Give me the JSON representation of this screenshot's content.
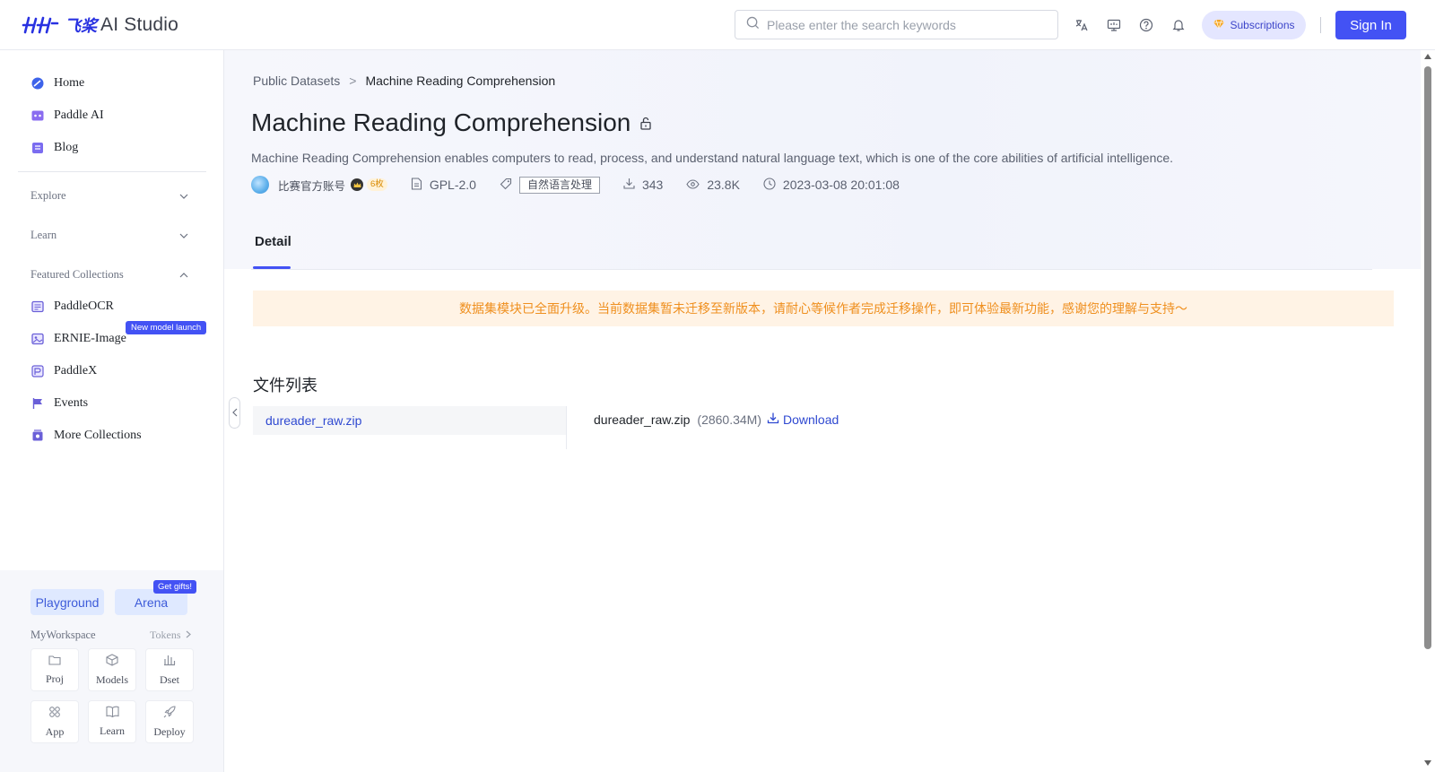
{
  "header": {
    "logo_cn": "飞桨",
    "logo_text": "AI Studio",
    "search_placeholder": "Please enter the search keywords",
    "icons": [
      "translate-icon",
      "monitor-icon",
      "help-icon",
      "bell-icon"
    ],
    "subscriptions_label": "Subscriptions",
    "sign_in_label": "Sign In"
  },
  "sidebar": {
    "items": [
      {
        "label": "Home",
        "icon": "home-icon"
      },
      {
        "label": "Paddle AI",
        "icon": "paddle-ai-icon"
      },
      {
        "label": "Blog",
        "icon": "blog-icon"
      }
    ],
    "sections": [
      {
        "label": "Explore",
        "expanded": false
      },
      {
        "label": "Learn",
        "expanded": false
      },
      {
        "label": "Featured Collections",
        "expanded": true
      }
    ],
    "collections": [
      {
        "label": "PaddleOCR",
        "icon": "ocr-icon"
      },
      {
        "label": "ERNIE-Image",
        "icon": "image-icon",
        "badge": "New model launch"
      },
      {
        "label": "PaddleX",
        "icon": "paddlex-icon"
      },
      {
        "label": "Events",
        "icon": "flag-icon"
      },
      {
        "label": "More Collections",
        "icon": "collections-icon"
      }
    ],
    "workspace": {
      "playground_label": "Playground",
      "arena_label": "Arena",
      "gift_badge": "Get gifts!",
      "title": "MyWorkspace",
      "tokens_label": "Tokens",
      "tiles": [
        {
          "label": "Proj",
          "icon": "folder-icon"
        },
        {
          "label": "Models",
          "icon": "cube-icon"
        },
        {
          "label": "Dset",
          "icon": "dataset-icon"
        },
        {
          "label": "App",
          "icon": "apps-icon"
        },
        {
          "label": "Learn",
          "icon": "book-icon"
        },
        {
          "label": "Deploy",
          "icon": "rocket-icon"
        }
      ]
    }
  },
  "main": {
    "breadcrumb": {
      "parent": "Public Datasets",
      "separator": ">",
      "current": "Machine Reading Comprehension"
    },
    "title": "Machine Reading Comprehension",
    "description": "Machine Reading Comprehension enables computers to read, process, and understand natural language text, which is one of the core abilities of artificial intelligence.",
    "meta": {
      "author": "比赛官方账号",
      "level": "6枚",
      "license": "GPL-2.0",
      "tag": "自然语言处理",
      "downloads": "343",
      "views": "23.8K",
      "updated": "2023-03-08 20:01:08"
    },
    "tabs": [
      {
        "label": "Detail",
        "active": true
      }
    ],
    "notice": "数据集模块已全面升级。当前数据集暂未迁移至新版本，请耐心等候作者完成迁移操作，即可体验最新功能，感谢您的理解与支持～",
    "files_title": "文件列表",
    "files": [
      {
        "name": "dureader_raw.zip",
        "size": "(2860.34M)",
        "download_label": "Download"
      }
    ]
  },
  "colors": {
    "accent": "#4352f4",
    "link": "#2f49d1",
    "notice_bg": "#fff3e5",
    "notice_text": "#ef8f1e"
  }
}
